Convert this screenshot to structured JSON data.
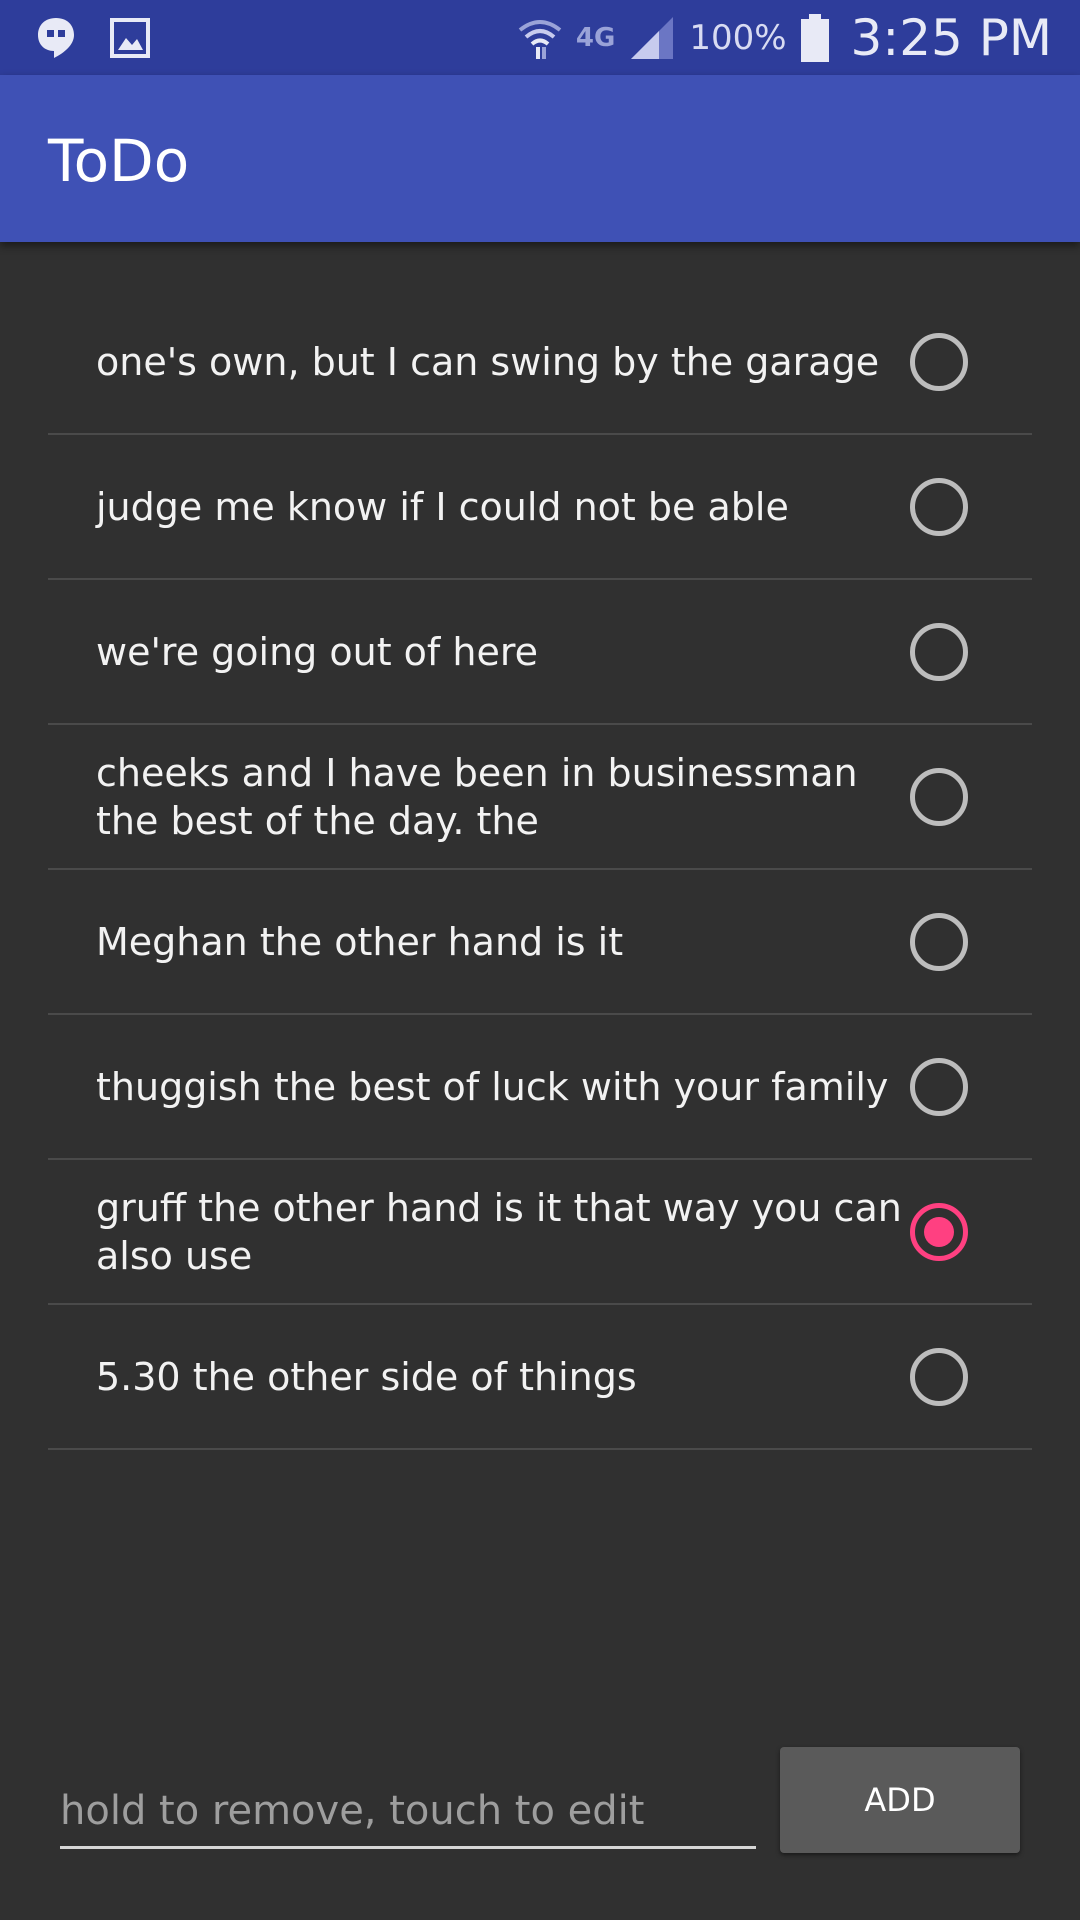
{
  "status_bar": {
    "network_label": "4G",
    "battery_text": "100%",
    "time": "3:25 PM",
    "icons": [
      "hangouts-icon",
      "gallery-icon",
      "wifi-icon",
      "signal-icon",
      "battery-icon"
    ]
  },
  "app_bar": {
    "title": "ToDo"
  },
  "todos": [
    {
      "text": "one's own, but I can swing by the garage",
      "checked": false
    },
    {
      "text": "judge me know if I could not be able",
      "checked": false
    },
    {
      "text": "we're going out of here",
      "checked": false
    },
    {
      "text": "cheeks and I have been in businessman the best of the day. the",
      "checked": false
    },
    {
      "text": "Meghan the other hand is it",
      "checked": false
    },
    {
      "text": "thuggish the best of luck with your family",
      "checked": false
    },
    {
      "text": "gruff the other hand is it that way you can also use",
      "checked": true
    },
    {
      "text": "5.30 the other side of things",
      "checked": false
    }
  ],
  "input": {
    "value": "",
    "placeholder": "hold to remove, touch to edit"
  },
  "add_button_label": "ADD",
  "colors": {
    "status_bar": "#2e3d9b",
    "app_bar": "#3f51b5",
    "background": "#303030",
    "accent": "#ff4081",
    "radio_unchecked": "#bdbdbd"
  }
}
